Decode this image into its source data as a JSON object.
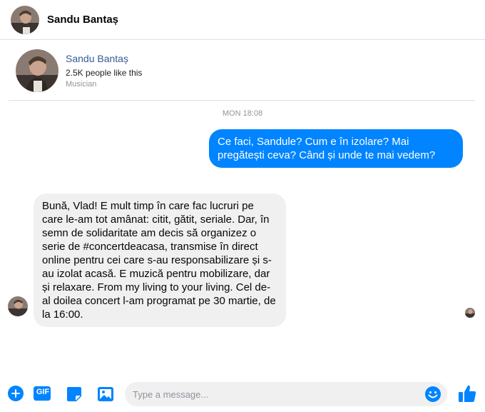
{
  "header": {
    "name": "Sandu Bantaș"
  },
  "profile": {
    "name": "Sandu Bantaș",
    "likes": "2.5K people like this",
    "category": "Musician"
  },
  "conversation": {
    "timestamp": "MON 18:08",
    "messages": [
      {
        "direction": "outgoing",
        "text": "Ce faci, Sandule? Cum e în izolare? Mai pregătești ceva? Când și unde te mai vedem?"
      },
      {
        "direction": "incoming",
        "text": "Bună, Vlad! E mult timp în care fac lucruri pe care le-am tot amânat: citit, gătit, seriale. Dar, în semn de solidaritate am decis să organizez o serie de #concertdeacasa, transmise în direct online pentru cei care s-au responsabilizare și s-au izolat acasă. E muzică  pentru mobilizare, dar și relaxare. From my living to your living. Cel de-al doilea concert l-am programat pe 30 martie, de la 16:00."
      }
    ]
  },
  "composer": {
    "placeholder": "Type a message...",
    "gif_label": "GIF"
  },
  "colors": {
    "accent": "#0084ff",
    "outgoing_bubble": "#0084ff",
    "incoming_bubble": "#f1f0f0",
    "link": "#385898"
  },
  "icons": [
    "add-icon",
    "gif-icon",
    "sticker-icon",
    "photo-icon",
    "emoji-icon",
    "like-icon"
  ]
}
